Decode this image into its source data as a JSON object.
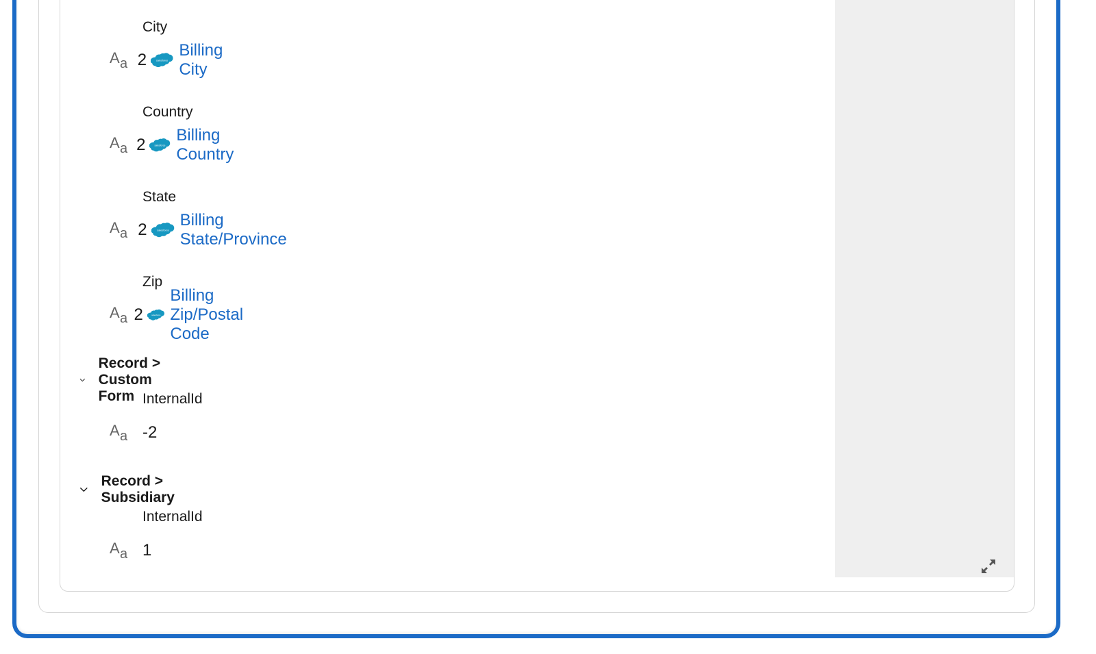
{
  "fields": [
    {
      "label": "City",
      "type_icon": "text-type-icon",
      "count": "2",
      "source_icon": "salesforce-logo-icon",
      "source_text": "salesforce",
      "link": "Billing City"
    },
    {
      "label": "Country",
      "type_icon": "text-type-icon",
      "count": "2",
      "source_icon": "salesforce-logo-icon",
      "source_text": "salesforce",
      "link": "Billing Country"
    },
    {
      "label": "State",
      "type_icon": "text-type-icon",
      "count": "2",
      "source_icon": "salesforce-logo-icon",
      "source_text": "salesforce",
      "link": "Billing State/Province"
    },
    {
      "label": "Zip",
      "type_icon": "text-type-icon",
      "count": "2",
      "source_icon": "salesforce-logo-icon",
      "source_text": "salesforce",
      "link": "Billing Zip/Postal Code"
    }
  ],
  "sections": [
    {
      "title": "Record > Custom Form",
      "expanded_icon": "chevron-down-icon",
      "field_label": "InternalId",
      "value": "-2"
    },
    {
      "title": "Record > Subsidiary",
      "expanded_icon": "chevron-down-icon",
      "field_label": "InternalId",
      "value": "1"
    }
  ],
  "type_icon_glyph": {
    "big": "A",
    "small": "a"
  },
  "expand_button": {
    "icon": "expand-icon"
  },
  "colors": {
    "accent": "#1b6ac6",
    "salesforce": "#1798c1",
    "panel": "#efefef"
  }
}
